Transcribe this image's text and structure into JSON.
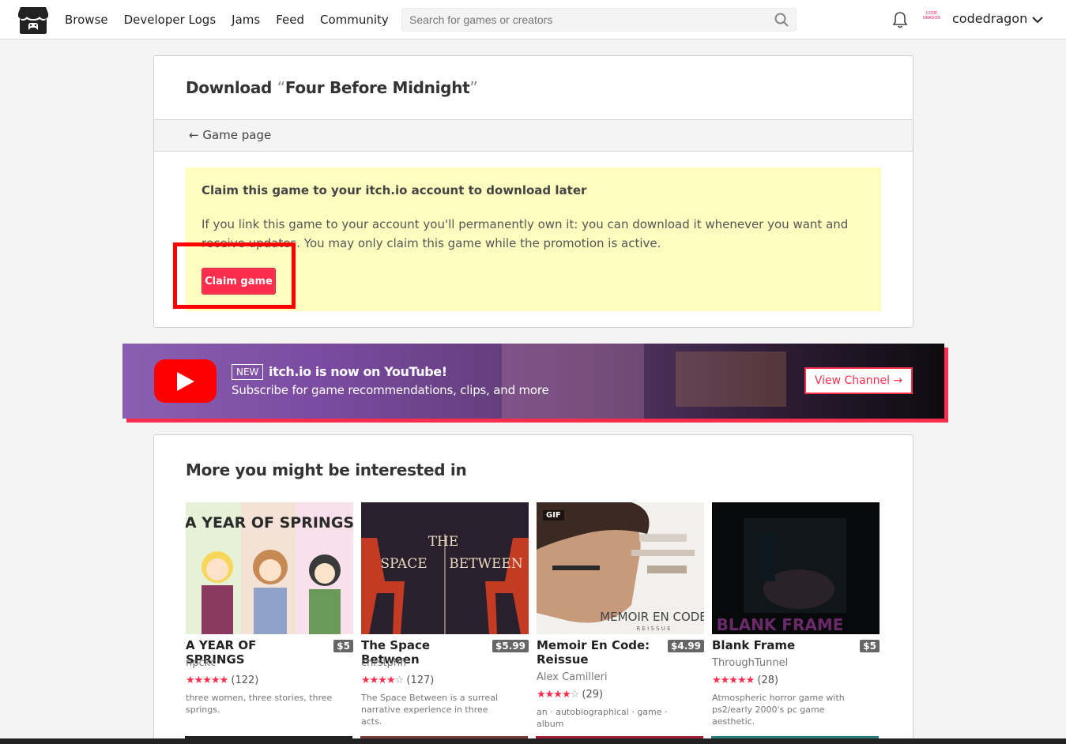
{
  "header": {
    "nav": [
      "Browse",
      "Developer Logs",
      "Jams",
      "Feed",
      "Community"
    ],
    "search_placeholder": "Search for games or creators",
    "username": "codedragon",
    "avatar_text": "CODE DRAGON"
  },
  "download": {
    "title_prefix": "Download",
    "title_quote_open": "“",
    "game_name": "Four Before Midnight",
    "title_quote_close": "”",
    "back_link": "← Game page",
    "claim_heading": "Claim this game to your itch.io account to download later",
    "claim_text": "If you link this game to your account you'll permanently own it: you can download it whenever you want and receive updates. You may only claim this game while the promotion is active.",
    "claim_button": "Claim game"
  },
  "youtube_banner": {
    "new_tag": "NEW",
    "title": "itch.io is now on YouTube!",
    "subtitle": "Subscribe for game recommendations, clips, and more",
    "button": "View Channel →"
  },
  "more": {
    "heading": "More you might be interested in",
    "games": [
      {
        "title": "A YEAR OF SPRINGS",
        "price": "$5",
        "author": "npckc",
        "stars_full": "★★★★★",
        "stars_empty": "",
        "rating_count": "(122)",
        "description": "three women, three stories, three springs.",
        "thumb_text": "A YEAR OF SPRINGS"
      },
      {
        "title": "The Space Between",
        "price": "$5.99",
        "author": "chrstphfr",
        "stars_full": "★★★★",
        "stars_empty": "☆",
        "rating_count": "(127)",
        "description": "The Space Between is a surreal narrative experience in three acts.",
        "thumb_text_1": "THE",
        "thumb_text_2": "SPACE",
        "thumb_text_3": "BETWEEN"
      },
      {
        "title": "Memoir En Code: Reissue",
        "price": "$4.99",
        "author": "Alex Camilleri",
        "stars_full": "★★★★",
        "stars_empty": "☆",
        "rating_count": "(29)",
        "description": "an · autobiographical · game · album",
        "gif_badge": "GIF",
        "thumb_text": "MEMOIR EN CODE",
        "thumb_sub": "R E I S S U E"
      },
      {
        "title": "Blank Frame",
        "price": "$5",
        "author": "ThroughTunnel",
        "stars_full": "★★★★★",
        "stars_empty": "",
        "rating_count": "(28)",
        "description": "Atmospheric horror game with ps2/early 2000's pc game aesthetic.",
        "thumb_text": "BLANK FRAME"
      }
    ]
  },
  "colors": {
    "accent": "#fa2e4c",
    "claim_bg": "#fefdc0",
    "highlight": "#ff0000",
    "youtube_red": "#ff0000"
  }
}
